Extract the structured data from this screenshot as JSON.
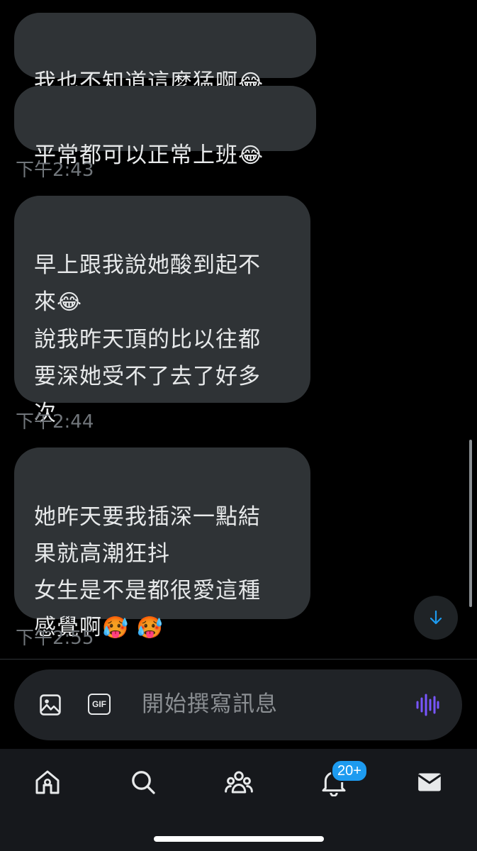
{
  "messages": [
    {
      "text": "我也不知道這麼猛啊",
      "emoji": "😂"
    },
    {
      "text": "平常都可以正常上班",
      "emoji": "😂",
      "time": "下午2:43"
    },
    {
      "text": "早上跟我說她酸到起不\n來",
      "emoji": "😂",
      "text2": "\n說我昨天頂的比以往都\n要深她受不了去了好多\n次",
      "time": "下午2:44"
    },
    {
      "text": "她昨天要我插深一點結\n果就高潮狂抖\n女生是不是都很愛這種\n感覺啊",
      "emoji": "🥵 🥵",
      "time": "下午2:55"
    }
  ],
  "composer": {
    "placeholder": "開始撰寫訊息",
    "gif_label": "GIF"
  },
  "nav": {
    "notifications_badge": "20+"
  },
  "colors": {
    "accent": "#1d9bf0",
    "voice": "#7856ff",
    "bubble": "#2f3336",
    "timestamp": "#71767b"
  },
  "icons": [
    "image-icon",
    "gif-icon",
    "voice-icon",
    "home-icon",
    "search-icon",
    "communities-icon",
    "notifications-icon",
    "messages-icon",
    "arrow-down-icon"
  ]
}
